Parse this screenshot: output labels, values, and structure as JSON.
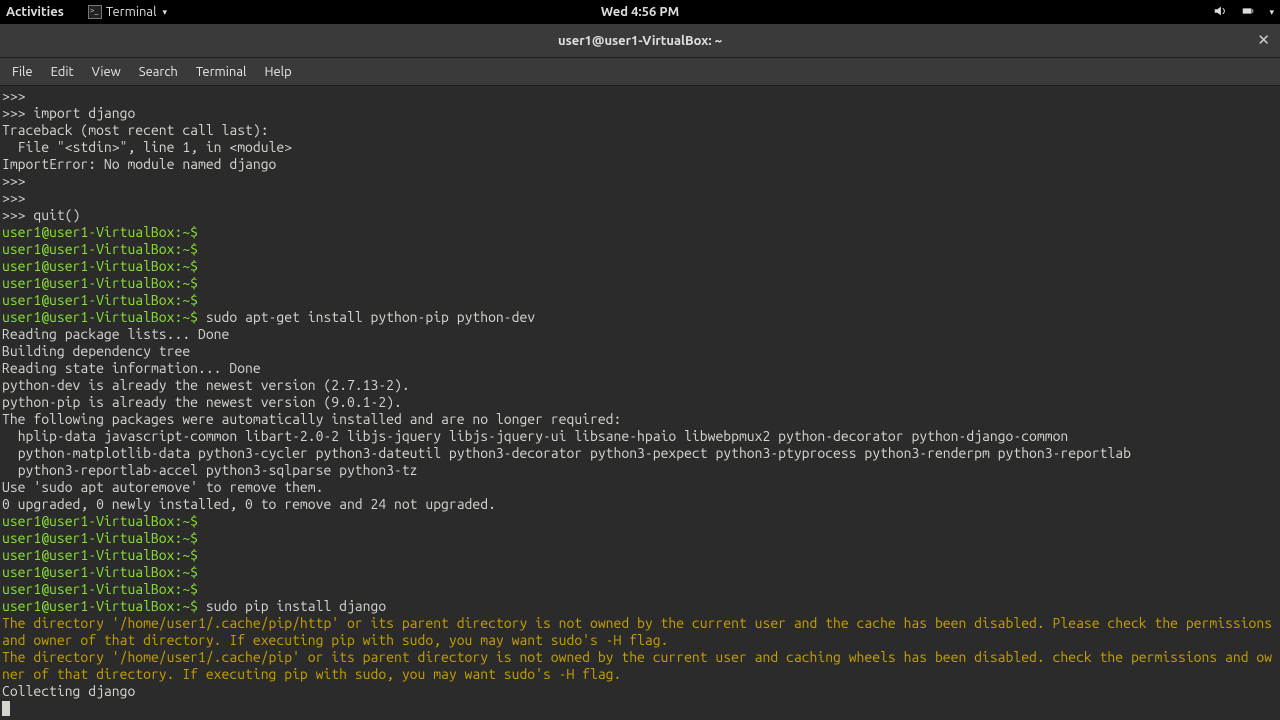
{
  "topbar": {
    "activities": "Activities",
    "app_name": "Terminal",
    "clock": "Wed  4:56 PM"
  },
  "window": {
    "title": "user1@user1-VirtualBox: ~",
    "close": "✕"
  },
  "menubar": [
    "File",
    "Edit",
    "View",
    "Search",
    "Terminal",
    "Help"
  ],
  "terminal": {
    "prompt": "user1@user1-VirtualBox:~$ ",
    "lines": [
      {
        "t": "plain",
        "text": ">>> "
      },
      {
        "t": "plain",
        "text": ">>> import django"
      },
      {
        "t": "plain",
        "text": "Traceback (most recent call last):"
      },
      {
        "t": "plain",
        "text": "  File \"<stdin>\", line 1, in <module>"
      },
      {
        "t": "plain",
        "text": "ImportError: No module named django"
      },
      {
        "t": "plain",
        "text": ">>> "
      },
      {
        "t": "plain",
        "text": ">>> "
      },
      {
        "t": "plain",
        "text": ">>> quit()"
      },
      {
        "t": "prompt",
        "cmd": ""
      },
      {
        "t": "prompt",
        "cmd": ""
      },
      {
        "t": "prompt",
        "cmd": ""
      },
      {
        "t": "prompt",
        "cmd": ""
      },
      {
        "t": "prompt",
        "cmd": ""
      },
      {
        "t": "prompt",
        "cmd": "sudo apt-get install python-pip python-dev"
      },
      {
        "t": "plain",
        "text": "Reading package lists... Done"
      },
      {
        "t": "plain",
        "text": "Building dependency tree       "
      },
      {
        "t": "plain",
        "text": "Reading state information... Done"
      },
      {
        "t": "plain",
        "text": "python-dev is already the newest version (2.7.13-2)."
      },
      {
        "t": "plain",
        "text": "python-pip is already the newest version (9.0.1-2)."
      },
      {
        "t": "plain",
        "text": "The following packages were automatically installed and are no longer required:"
      },
      {
        "t": "plain",
        "text": "  hplip-data javascript-common libart-2.0-2 libjs-jquery libjs-jquery-ui libsane-hpaio libwebpmux2 python-decorator python-django-common"
      },
      {
        "t": "plain",
        "text": "  python-matplotlib-data python3-cycler python3-dateutil python3-decorator python3-pexpect python3-ptyprocess python3-renderpm python3-reportlab"
      },
      {
        "t": "plain",
        "text": "  python3-reportlab-accel python3-sqlparse python3-tz"
      },
      {
        "t": "plain",
        "text": "Use 'sudo apt autoremove' to remove them."
      },
      {
        "t": "plain",
        "text": "0 upgraded, 0 newly installed, 0 to remove and 24 not upgraded."
      },
      {
        "t": "prompt",
        "cmd": ""
      },
      {
        "t": "prompt",
        "cmd": ""
      },
      {
        "t": "prompt",
        "cmd": ""
      },
      {
        "t": "prompt",
        "cmd": ""
      },
      {
        "t": "prompt",
        "cmd": ""
      },
      {
        "t": "prompt",
        "cmd": "sudo pip install django"
      },
      {
        "t": "warn",
        "text": "The directory '/home/user1/.cache/pip/http' or its parent directory is not owned by the current user and the cache has been disabled. Please check the permissions and owner of that directory. If executing pip with sudo, you may want sudo's -H flag."
      },
      {
        "t": "warn",
        "text": "The directory '/home/user1/.cache/pip' or its parent directory is not owned by the current user and caching wheels has been disabled. check the permissions and owner of that directory. If executing pip with sudo, you may want sudo's -H flag."
      },
      {
        "t": "plain",
        "text": "Collecting django"
      }
    ]
  }
}
